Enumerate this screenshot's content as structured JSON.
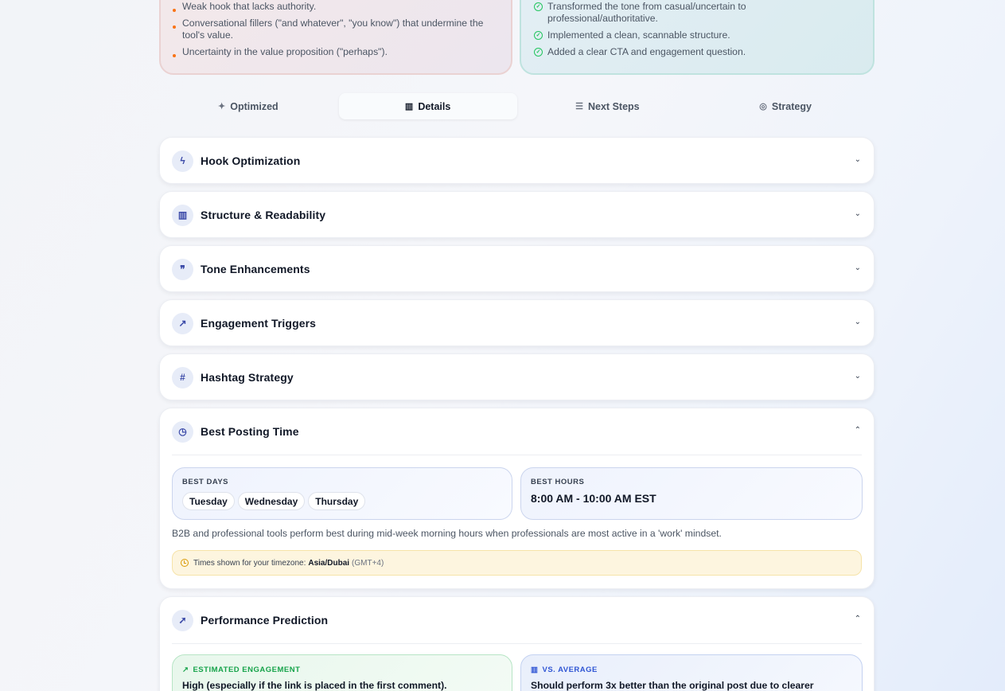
{
  "summary": {
    "problems": [
      "Weak hook that lacks authority.",
      "Conversational fillers (\"and whatever\", \"you know\") that undermine the tool's value.",
      "Uncertainty in the value proposition (\"perhaps\")."
    ],
    "wins": [
      "Transformed the tone from casual/uncertain to professional/authoritative.",
      "Implemented a clean, scannable structure.",
      "Added a clear CTA and engagement question."
    ]
  },
  "tabs": [
    {
      "label": "Optimized",
      "icon": "sparkles-icon",
      "active": false
    },
    {
      "label": "Details",
      "icon": "bar-chart-icon",
      "active": true
    },
    {
      "label": "Next Steps",
      "icon": "list-checks-icon",
      "active": false
    },
    {
      "label": "Strategy",
      "icon": "target-icon",
      "active": false
    }
  ],
  "sections": [
    {
      "title": "Hook Optimization",
      "icon": "zap-icon",
      "expanded": false
    },
    {
      "title": "Structure & Readability",
      "icon": "bar-chart-icon",
      "expanded": false
    },
    {
      "title": "Tone Enhancements",
      "icon": "message-quote-icon",
      "expanded": false
    },
    {
      "title": "Engagement Triggers",
      "icon": "trending-up-icon",
      "expanded": false
    },
    {
      "title": "Hashtag Strategy",
      "icon": "hash-icon",
      "expanded": false
    },
    {
      "title": "Best Posting Time",
      "icon": "clock-icon",
      "expanded": true
    },
    {
      "title": "Performance Prediction",
      "icon": "rocket-icon",
      "expanded": true
    }
  ],
  "posting_time": {
    "best_days_label": "BEST DAYS",
    "best_days": [
      "Tuesday",
      "Wednesday",
      "Thursday"
    ],
    "best_hours_label": "BEST HOURS",
    "best_hours": "8:00 AM - 10:00 AM EST",
    "description": "B2B and professional tools perform best during mid-week morning hours when professionals are most active in a 'work' mindset.",
    "timezone_prefix": "Times shown for your timezone:",
    "timezone": "Asia/Dubai",
    "timezone_offset": "(GMT+4)"
  },
  "performance": {
    "engagement_label": "ESTIMATED ENGAGEMENT",
    "engagement_text": "High (especially if the link is placed in the first comment).",
    "average_label": "VS. AVERAGE",
    "average_text": "Should perform 3x better than the original post due to clearer"
  },
  "colors": {
    "accent": "#3b4aa8",
    "warning_dot": "#f97316",
    "success": "#22c55e",
    "engagement_green": "#16a34a",
    "average_blue": "#2f55d4"
  }
}
